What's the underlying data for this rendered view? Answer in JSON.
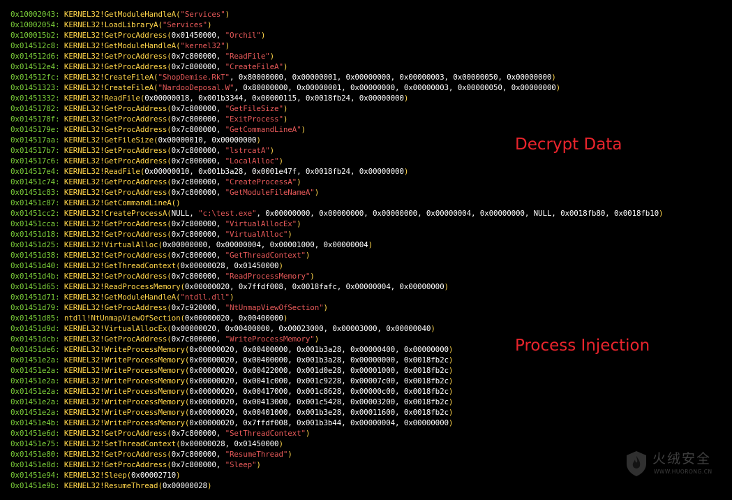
{
  "colors": {
    "background": "#000000",
    "address": "#7ccf3a",
    "api": "#ffd54a",
    "string": "#e45858",
    "plain": "#ffffff",
    "annotation": "#e8242c"
  },
  "annotations": {
    "decrypt": "Decrypt Data",
    "injection": "Process Injection"
  },
  "watermark": {
    "icon": "huorong-shield-icon",
    "text": "火绒安全",
    "url": "WWW.HUORONG.CN"
  },
  "trace_lines": [
    [
      [
        "a",
        "0x10002043:"
      ],
      [
        "p",
        " "
      ],
      [
        "k",
        "KERNEL32!GetModuleHandleA("
      ],
      [
        "s",
        "\"Services\""
      ],
      [
        "k",
        ")"
      ]
    ],
    [
      [
        "a",
        "0x10002054:"
      ],
      [
        "p",
        " "
      ],
      [
        "k",
        "KERNEL32!LoadLibraryA("
      ],
      [
        "s",
        "\"Services\""
      ],
      [
        "k",
        ")"
      ]
    ],
    [
      [
        "a",
        "0x100015b2:"
      ],
      [
        "p",
        " "
      ],
      [
        "k",
        "KERNEL32!GetProcAddress("
      ],
      [
        "p",
        "0x01450000, "
      ],
      [
        "s",
        "\"Orchil\""
      ],
      [
        "k",
        ")"
      ]
    ],
    [
      [
        "a",
        "0x014512c8:"
      ],
      [
        "p",
        " "
      ],
      [
        "k",
        "KERNEL32!GetModuleHandleA("
      ],
      [
        "s",
        "\"kernel32\""
      ],
      [
        "k",
        ")"
      ]
    ],
    [
      [
        "a",
        "0x014512d6:"
      ],
      [
        "p",
        " "
      ],
      [
        "k",
        "KERNEL32!GetProcAddress("
      ],
      [
        "p",
        "0x7c800000, "
      ],
      [
        "s",
        "\"ReadFile\""
      ],
      [
        "k",
        ")"
      ]
    ],
    [
      [
        "a",
        "0x014512e4:"
      ],
      [
        "p",
        " "
      ],
      [
        "k",
        "KERNEL32!GetProcAddress("
      ],
      [
        "p",
        "0x7c800000, "
      ],
      [
        "s",
        "\"CreateFileA\""
      ],
      [
        "k",
        ")"
      ]
    ],
    [
      [
        "a",
        "0x014512fc:"
      ],
      [
        "p",
        " "
      ],
      [
        "k",
        "KERNEL32!CreateFileA("
      ],
      [
        "s",
        "\"ShopDemise.RkT\""
      ],
      [
        "p",
        ", 0x80000000, 0x00000001, 0x00000000, 0x00000003, 0x00000050, 0x00000000"
      ],
      [
        "k",
        ")"
      ]
    ],
    [
      [
        "a",
        "0x01451323:"
      ],
      [
        "p",
        " "
      ],
      [
        "k",
        "KERNEL32!CreateFileA("
      ],
      [
        "s",
        "\"NardooDeposal.W\""
      ],
      [
        "p",
        ", 0x80000000, 0x00000001, 0x00000000, 0x00000003, 0x00000050, 0x00000000"
      ],
      [
        "k",
        ")"
      ]
    ],
    [
      [
        "a",
        "0x01451332:"
      ],
      [
        "p",
        " "
      ],
      [
        "k",
        "KERNEL32!ReadFile("
      ],
      [
        "p",
        "0x00000018, 0x001b3344, 0x00000115, 0x0018fb24, 0x00000000"
      ],
      [
        "k",
        ")"
      ]
    ],
    [
      [
        "a",
        "0x01451782:"
      ],
      [
        "p",
        " "
      ],
      [
        "k",
        "KERNEL32!GetProcAddress("
      ],
      [
        "p",
        "0x7c800000, "
      ],
      [
        "s",
        "\"GetFileSize\""
      ],
      [
        "k",
        ")"
      ]
    ],
    [
      [
        "a",
        "0x0145178f:"
      ],
      [
        "p",
        " "
      ],
      [
        "k",
        "KERNEL32!GetProcAddress("
      ],
      [
        "p",
        "0x7c800000, "
      ],
      [
        "s",
        "\"ExitProcess\""
      ],
      [
        "k",
        ")"
      ]
    ],
    [
      [
        "a",
        "0x0145179e:"
      ],
      [
        "p",
        " "
      ],
      [
        "k",
        "KERNEL32!GetProcAddress("
      ],
      [
        "p",
        "0x7c800000, "
      ],
      [
        "s",
        "\"GetCommandLineA\""
      ],
      [
        "k",
        ")"
      ]
    ],
    [
      [
        "a",
        "0x014517aa:"
      ],
      [
        "p",
        " "
      ],
      [
        "k",
        "KERNEL32!GetFileSize("
      ],
      [
        "p",
        "0x00000010, 0x00000000"
      ],
      [
        "k",
        ")"
      ]
    ],
    [
      [
        "a",
        "0x014517b7:"
      ],
      [
        "p",
        " "
      ],
      [
        "k",
        "KERNEL32!GetProcAddress("
      ],
      [
        "p",
        "0x7c800000, "
      ],
      [
        "s",
        "\"lstrcatA\""
      ],
      [
        "k",
        ")"
      ]
    ],
    [
      [
        "a",
        "0x014517c6:"
      ],
      [
        "p",
        " "
      ],
      [
        "k",
        "KERNEL32!GetProcAddress("
      ],
      [
        "p",
        "0x7c800000, "
      ],
      [
        "s",
        "\"LocalAlloc\""
      ],
      [
        "k",
        ")"
      ]
    ],
    [
      [
        "a",
        "0x014517e4:"
      ],
      [
        "p",
        " "
      ],
      [
        "k",
        "KERNEL32!ReadFile("
      ],
      [
        "p",
        "0x00000010, 0x001b3a28, 0x0001e47f, 0x0018fb24, 0x00000000"
      ],
      [
        "k",
        ")"
      ]
    ],
    [
      [
        "a",
        "0x01451c74:"
      ],
      [
        "p",
        " "
      ],
      [
        "k",
        "KERNEL32!GetProcAddress("
      ],
      [
        "p",
        "0x7c800000, "
      ],
      [
        "s",
        "\"CreateProcessA\""
      ],
      [
        "k",
        ")"
      ]
    ],
    [
      [
        "a",
        "0x01451c83:"
      ],
      [
        "p",
        " "
      ],
      [
        "k",
        "KERNEL32!GetProcAddress("
      ],
      [
        "p",
        "0x7c800000, "
      ],
      [
        "s",
        "\"GetModuleFileNameA\""
      ],
      [
        "k",
        ")"
      ]
    ],
    [
      [
        "a",
        "0x01451c87:"
      ],
      [
        "p",
        " "
      ],
      [
        "k",
        "KERNEL32!GetCommandLineA()"
      ]
    ],
    [
      [
        "a",
        "0x01451cc2:"
      ],
      [
        "p",
        " "
      ],
      [
        "k",
        "KERNEL32!CreateProcessA("
      ],
      [
        "p",
        "NULL, "
      ],
      [
        "s",
        "\"c:\\test.exe\""
      ],
      [
        "p",
        ", 0x00000000, 0x00000000, 0x00000000, 0x00000004, 0x00000000, NULL, 0x0018fb80, 0x0018fb10"
      ],
      [
        "k",
        ")"
      ]
    ],
    [
      [
        "a",
        "0x01451cca:"
      ],
      [
        "p",
        " "
      ],
      [
        "k",
        "KERNEL32!GetProcAddress("
      ],
      [
        "p",
        "0x7c800000, "
      ],
      [
        "s",
        "\"VirtualAllocEx\""
      ],
      [
        "k",
        ")"
      ]
    ],
    [
      [
        "a",
        "0x01451d18:"
      ],
      [
        "p",
        " "
      ],
      [
        "k",
        "KERNEL32!GetProcAddress("
      ],
      [
        "p",
        "0x7c800000, "
      ],
      [
        "s",
        "\"VirtualAlloc\""
      ],
      [
        "k",
        ")"
      ]
    ],
    [
      [
        "a",
        "0x01451d25:"
      ],
      [
        "p",
        " "
      ],
      [
        "k",
        "KERNEL32!VirtualAlloc("
      ],
      [
        "p",
        "0x00000000, 0x00000004, 0x00001000, 0x00000004"
      ],
      [
        "k",
        ")"
      ]
    ],
    [
      [
        "a",
        "0x01451d38:"
      ],
      [
        "p",
        " "
      ],
      [
        "k",
        "KERNEL32!GetProcAddress("
      ],
      [
        "p",
        "0x7c800000, "
      ],
      [
        "s",
        "\"GetThreadContext\""
      ],
      [
        "k",
        ")"
      ]
    ],
    [
      [
        "a",
        "0x01451d40:"
      ],
      [
        "p",
        " "
      ],
      [
        "k",
        "KERNEL32!GetThreadContext("
      ],
      [
        "p",
        "0x00000028, 0x01450000"
      ],
      [
        "k",
        ")"
      ]
    ],
    [
      [
        "a",
        "0x01451d4b:"
      ],
      [
        "p",
        " "
      ],
      [
        "k",
        "KERNEL32!GetProcAddress("
      ],
      [
        "p",
        "0x7c800000, "
      ],
      [
        "s",
        "\"ReadProcessMemory\""
      ],
      [
        "k",
        ")"
      ]
    ],
    [
      [
        "a",
        "0x01451d65:"
      ],
      [
        "p",
        " "
      ],
      [
        "k",
        "KERNEL32!ReadProcessMemory("
      ],
      [
        "p",
        "0x00000020, 0x7ffdf008, 0x0018fafc, 0x00000004, 0x00000000"
      ],
      [
        "k",
        ")"
      ]
    ],
    [
      [
        "a",
        "0x01451d71:"
      ],
      [
        "p",
        " "
      ],
      [
        "k",
        "KERNEL32!GetModuleHandleA("
      ],
      [
        "s",
        "\"ntdll.dll\""
      ],
      [
        "k",
        ")"
      ]
    ],
    [
      [
        "a",
        "0x01451d79:"
      ],
      [
        "p",
        " "
      ],
      [
        "k",
        "KERNEL32!GetProcAddress("
      ],
      [
        "p",
        "0x7c920000, "
      ],
      [
        "s",
        "\"NtUnmapViewOfSection\""
      ],
      [
        "k",
        ")"
      ]
    ],
    [
      [
        "a",
        "0x01451d85:"
      ],
      [
        "p",
        " "
      ],
      [
        "k",
        "ntdll!NtUnmapViewOfSection("
      ],
      [
        "p",
        "0x00000020, 0x00400000"
      ],
      [
        "k",
        ")"
      ]
    ],
    [
      [
        "a",
        "0x01451d9d:"
      ],
      [
        "p",
        " "
      ],
      [
        "k",
        "KERNEL32!VirtualAllocEx("
      ],
      [
        "p",
        "0x00000020, 0x00400000, 0x00023000, 0x00003000, 0x00000040"
      ],
      [
        "k",
        ")"
      ]
    ],
    [
      [
        "a",
        "0x01451dcb:"
      ],
      [
        "p",
        " "
      ],
      [
        "k",
        "KERNEL32!GetProcAddress("
      ],
      [
        "p",
        "0x7c800000, "
      ],
      [
        "s",
        "\"WriteProcessMemory\""
      ],
      [
        "k",
        ")"
      ]
    ],
    [
      [
        "a",
        "0x01451de6:"
      ],
      [
        "p",
        " "
      ],
      [
        "k",
        "KERNEL32!WriteProcessMemory("
      ],
      [
        "p",
        "0x00000020, 0x00400000, 0x001b3a28, 0x00000400, 0x00000000"
      ],
      [
        "k",
        ")"
      ]
    ],
    [
      [
        "a",
        "0x01451e2a:"
      ],
      [
        "p",
        " "
      ],
      [
        "k",
        "KERNEL32!WriteProcessMemory("
      ],
      [
        "p",
        "0x00000020, 0x00400000, 0x001b3a28, 0x00000000, 0x0018fb2c"
      ],
      [
        "k",
        ")"
      ]
    ],
    [
      [
        "a",
        "0x01451e2a:"
      ],
      [
        "p",
        " "
      ],
      [
        "k",
        "KERNEL32!WriteProcessMemory("
      ],
      [
        "p",
        "0x00000020, 0x00422000, 0x001d0e28, 0x00001000, 0x0018fb2c"
      ],
      [
        "k",
        ")"
      ]
    ],
    [
      [
        "a",
        "0x01451e2a:"
      ],
      [
        "p",
        " "
      ],
      [
        "k",
        "KERNEL32!WriteProcessMemory("
      ],
      [
        "p",
        "0x00000020, 0x0041c000, 0x001c9228, 0x00007c00, 0x0018fb2c"
      ],
      [
        "k",
        ")"
      ]
    ],
    [
      [
        "a",
        "0x01451e2a:"
      ],
      [
        "p",
        " "
      ],
      [
        "k",
        "KERNEL32!WriteProcessMemory("
      ],
      [
        "p",
        "0x00000020, 0x00417000, 0x001c8628, 0x00000c00, 0x0018fb2c"
      ],
      [
        "k",
        ")"
      ]
    ],
    [
      [
        "a",
        "0x01451e2a:"
      ],
      [
        "p",
        " "
      ],
      [
        "k",
        "KERNEL32!WriteProcessMemory("
      ],
      [
        "p",
        "0x00000020, 0x00413000, 0x001c5428, 0x00003200, 0x0018fb2c"
      ],
      [
        "k",
        ")"
      ]
    ],
    [
      [
        "a",
        "0x01451e2a:"
      ],
      [
        "p",
        " "
      ],
      [
        "k",
        "KERNEL32!WriteProcessMemory("
      ],
      [
        "p",
        "0x00000020, 0x00401000, 0x001b3e28, 0x00011600, 0x0018fb2c"
      ],
      [
        "k",
        ")"
      ]
    ],
    [
      [
        "a",
        "0x01451e4b:"
      ],
      [
        "p",
        " "
      ],
      [
        "k",
        "KERNEL32!WriteProcessMemory("
      ],
      [
        "p",
        "0x00000020, 0x7ffdf008, 0x001b3b44, 0x00000004, 0x00000000"
      ],
      [
        "k",
        ")"
      ]
    ],
    [
      [
        "a",
        "0x01451e6d:"
      ],
      [
        "p",
        " "
      ],
      [
        "k",
        "KERNEL32!GetProcAddress("
      ],
      [
        "p",
        "0x7c800000, "
      ],
      [
        "s",
        "\"SetThreadContext\""
      ],
      [
        "k",
        ")"
      ]
    ],
    [
      [
        "a",
        "0x01451e75:"
      ],
      [
        "p",
        " "
      ],
      [
        "k",
        "KERNEL32!SetThreadContext("
      ],
      [
        "p",
        "0x00000028, 0x01450000"
      ],
      [
        "k",
        ")"
      ]
    ],
    [
      [
        "a",
        "0x01451e80:"
      ],
      [
        "p",
        " "
      ],
      [
        "k",
        "KERNEL32!GetProcAddress("
      ],
      [
        "p",
        "0x7c800000, "
      ],
      [
        "s",
        "\"ResumeThread\""
      ],
      [
        "k",
        ")"
      ]
    ],
    [
      [
        "a",
        "0x01451e8d:"
      ],
      [
        "p",
        " "
      ],
      [
        "k",
        "KERNEL32!GetProcAddress("
      ],
      [
        "p",
        "0x7c800000, "
      ],
      [
        "s",
        "\"Sleep\""
      ],
      [
        "k",
        ")"
      ]
    ],
    [
      [
        "a",
        "0x01451e94:"
      ],
      [
        "p",
        " "
      ],
      [
        "k",
        "KERNEL32!Sleep("
      ],
      [
        "p",
        "0x00002710"
      ],
      [
        "k",
        ")"
      ]
    ],
    [
      [
        "a",
        "0x01451e9b:"
      ],
      [
        "p",
        " "
      ],
      [
        "k",
        "KERNEL32!ResumeThread("
      ],
      [
        "p",
        "0x00000028"
      ],
      [
        "k",
        ")"
      ]
    ]
  ]
}
